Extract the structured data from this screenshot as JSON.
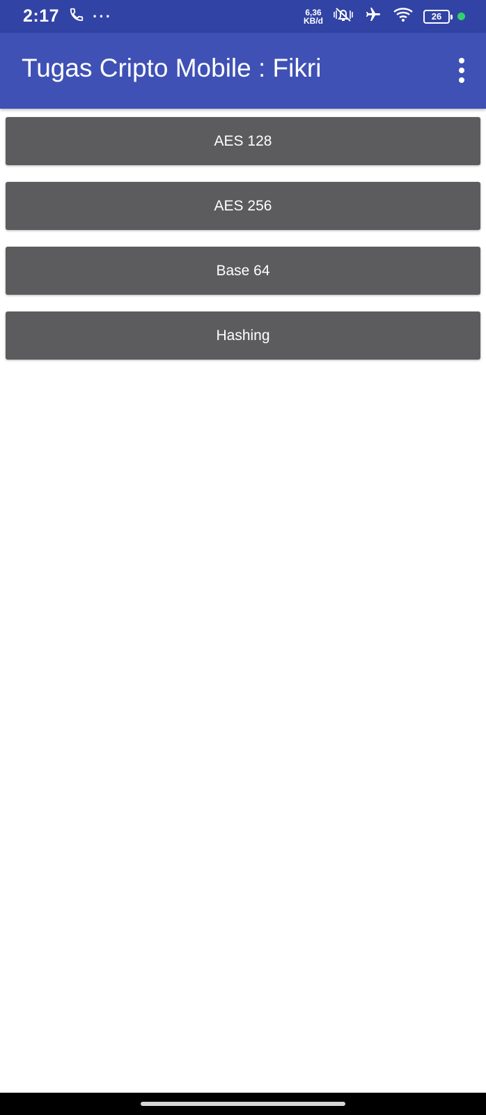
{
  "status_bar": {
    "time": "2:17",
    "ellipsis": "···",
    "net_speed_value": "6,36",
    "net_speed_unit": "KB/d",
    "battery": "26",
    "icons": [
      "phone-icon",
      "vibrate-silent-icon",
      "airplane-icon",
      "wifi-icon",
      "battery-icon"
    ],
    "dot_color": "#32d06a"
  },
  "app_bar": {
    "title": "Tugas Cripto Mobile : Fikri",
    "color": "#3f51b5",
    "overflow_icon": "more-vert-icon"
  },
  "buttons": [
    {
      "label": "AES 128"
    },
    {
      "label": "AES 256"
    },
    {
      "label": "Base 64"
    },
    {
      "label": "Hashing"
    }
  ],
  "colors": {
    "status_bar": "#3143a4",
    "button_bg": "#5c5c5e",
    "button_text": "#ffffff"
  }
}
